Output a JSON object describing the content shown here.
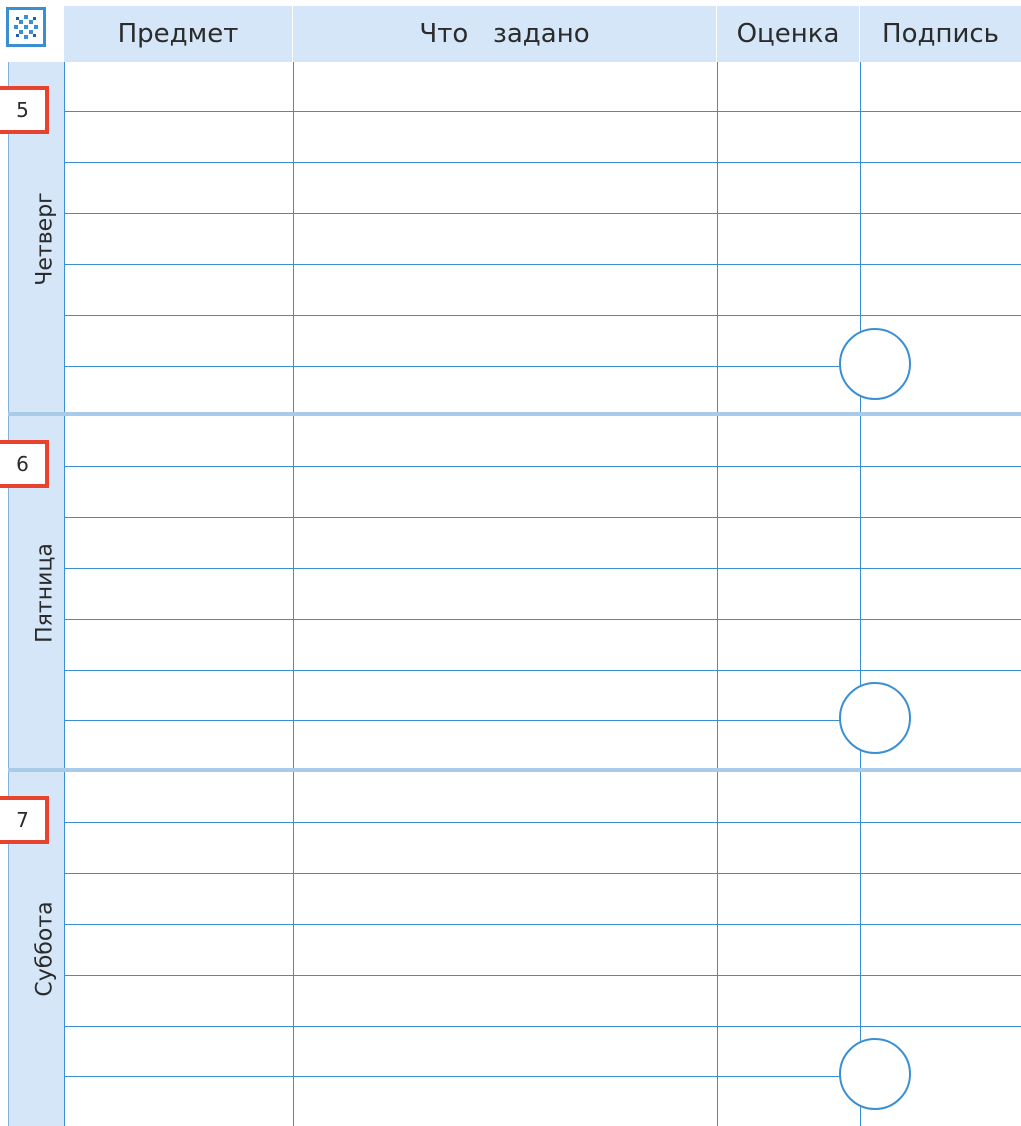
{
  "header": {
    "logo_icon": "snowflake-ornament-icon",
    "columns": {
      "subject": "Предмет",
      "task": "Что   задано",
      "grade": "Оценка",
      "signature": "Подпись"
    }
  },
  "days": [
    {
      "number": "5",
      "name": "Четверг"
    },
    {
      "number": "6",
      "name": "Пятница"
    },
    {
      "number": "7",
      "name": "Суббота"
    }
  ],
  "colors": {
    "accent": "#3a8fd3",
    "header_fill": "#d4e6f7",
    "badge_border": "#e8432e"
  }
}
